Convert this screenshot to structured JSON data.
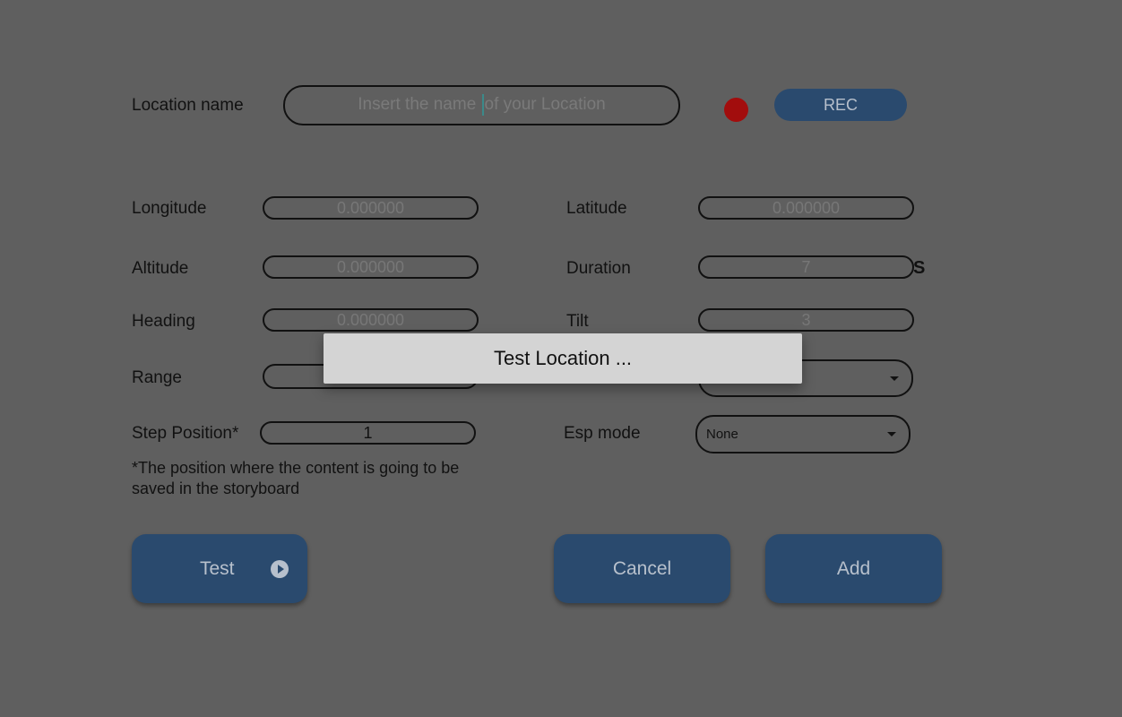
{
  "form": {
    "location_name_label": "Location name",
    "location_name_placeholder": "Insert the name of your Location",
    "location_name_placeholder_a": "Insert the name ",
    "location_name_placeholder_b": "of your Location",
    "rec_label": "REC",
    "longitude_label": "Longitude",
    "longitude_value": "0.000000",
    "latitude_label": "Latitude",
    "latitude_value": "0.000000",
    "altitude_label": "Altitude",
    "altitude_value": "0.000000",
    "duration_label": "Duration",
    "duration_value": "7",
    "duration_unit": "S",
    "heading_label": "Heading",
    "heading_value": "0.000000",
    "tilt_label": "Tilt",
    "tilt_value": "3",
    "range_label": "Range",
    "step_position_label": "Step Position*",
    "step_position_value": "1",
    "esp_mode_label": "Esp mode",
    "esp_mode_value": "None",
    "note_line1": "*The position where the content is going to be",
    "note_line2": "saved in the storyboard"
  },
  "buttons": {
    "test": "Test",
    "cancel": "Cancel",
    "add": "Add"
  },
  "toast": {
    "message": "Test Location ..."
  },
  "colors": {
    "overlay_bg": "#5f5f5f",
    "button_bg": "#2a4a6e",
    "record_dot": "#a20d0d",
    "toast_bg": "#d4d4d4"
  },
  "icons": {
    "record": "red-dot",
    "test": "play-circle-icon",
    "dropdown": "caret-down-icon"
  }
}
